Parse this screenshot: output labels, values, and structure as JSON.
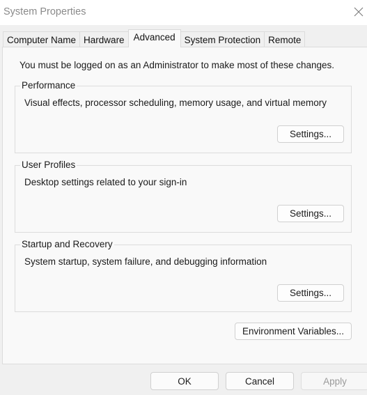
{
  "window": {
    "title": "System Properties",
    "close_icon": "close-icon"
  },
  "tabs": [
    {
      "label": "Computer Name",
      "active": false
    },
    {
      "label": "Hardware",
      "active": false
    },
    {
      "label": "Advanced",
      "active": true
    },
    {
      "label": "System Protection",
      "active": false
    },
    {
      "label": "Remote",
      "active": false
    }
  ],
  "advanced": {
    "notice": "You must be logged on as an Administrator to make most of these changes.",
    "groups": [
      {
        "label": "Performance",
        "description": "Visual effects, processor scheduling, memory usage, and virtual memory",
        "button": "Settings..."
      },
      {
        "label": "User Profiles",
        "description": "Desktop settings related to your sign-in",
        "button": "Settings..."
      },
      {
        "label": "Startup and Recovery",
        "description": "System startup, system failure, and debugging information",
        "button": "Settings..."
      }
    ],
    "env_button": "Environment Variables..."
  },
  "footer": {
    "ok": "OK",
    "cancel": "Cancel",
    "apply": "Apply",
    "apply_disabled": true
  }
}
